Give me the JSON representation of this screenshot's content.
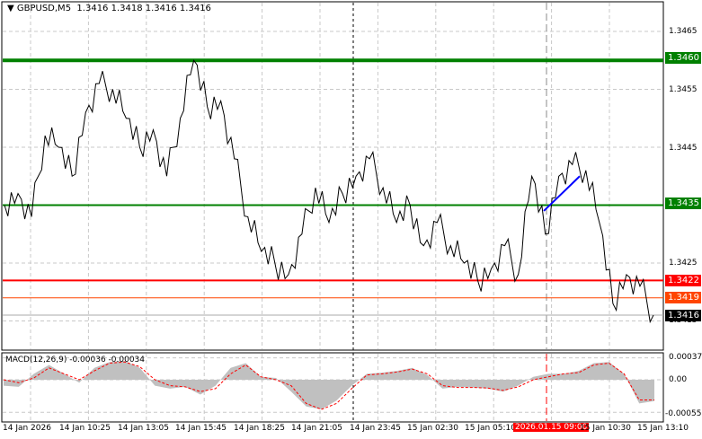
{
  "header": {
    "symbol": "GBPUSD,M5",
    "ohlc": "1.3416 1.3418 1.3416 1.3416"
  },
  "price_scale": [
    "1.3465",
    "1.3455",
    "1.3445",
    "1.3425",
    "1.3415"
  ],
  "levels": [
    {
      "price": 1.346,
      "label": "1.3460",
      "color": "#008000"
    },
    {
      "price": 1.3435,
      "label": "1.3435",
      "color": "#008000"
    },
    {
      "price": 1.3422,
      "label": "1.3422",
      "color": "#ff0000"
    },
    {
      "price": 1.3419,
      "label": "1.3419",
      "color": "#ff4500"
    },
    {
      "price": 1.3416,
      "label": "1.3416",
      "color": "#000000"
    }
  ],
  "macd": {
    "label": "MACD(12,26,9) -0.00036 -0.00034",
    "scale": [
      "0.00037",
      "0.00",
      "-0.00055"
    ]
  },
  "time_labels": [
    "14 Jan 2026",
    "14 Jan 10:25",
    "14 Jan 13:05",
    "14 Jan 15:45",
    "14 Jan 18:25",
    "14 Jan 21:05",
    "14 Jan 23:45",
    "15 Jan 02:30",
    "15 Jan 05:10",
    "2026.01.15 09:00",
    "15 Jan 10:30",
    "15 Jan 13:10"
  ],
  "chart_data": {
    "type": "line",
    "price": [
      1.3435,
      1.3437,
      1.3433,
      1.3447,
      1.3445,
      1.344,
      1.3451,
      1.3456,
      1.3455,
      1.345,
      1.3445,
      1.3448,
      1.344,
      1.345,
      1.346,
      1.3452,
      1.3453,
      1.3443,
      1.3433,
      1.3427,
      1.3425,
      1.3423,
      1.343,
      1.3438,
      1.3432,
      1.3437,
      1.344,
      1.3443,
      1.3438,
      1.3432,
      1.3435,
      1.3428,
      1.3432,
      1.3428,
      1.3425,
      1.3422,
      1.3424,
      1.3428,
      1.3423,
      1.344,
      1.343,
      1.344,
      1.3442,
      1.3441,
      1.3432,
      1.3418,
      1.3423,
      1.3421,
      1.3416
    ],
    "trendline": [
      1.3434,
      1.344
    ],
    "macd_hist": [
      -0.0001,
      -0.00012,
      0.0001,
      0.00025,
      0.0001,
      -5e-05,
      0.0002,
      0.0003,
      0.00032,
      0.0002,
      -0.0001,
      -0.00015,
      -0.00012,
      -0.00025,
      -0.0001,
      0.0002,
      0.00028,
      5e-05,
      3e-05,
      -0.0002,
      -0.00045,
      -0.0005,
      -0.00035,
      -0.0001,
      0.0001,
      0.00012,
      0.00015,
      0.0002,
      8e-05,
      -0.00015,
      -0.00012,
      -0.00013,
      -0.00015,
      -0.0002,
      -0.0001,
      5e-05,
      0.0001,
      0.0001,
      0.00015,
      0.00028,
      0.0003,
      0.0001,
      -0.0004,
      -0.00036
    ],
    "macd_signal": [
      0.0,
      -5e-05,
      3e-05,
      0.0002,
      0.0001,
      0.0,
      0.00015,
      0.00028,
      0.0003,
      0.00022,
      0.0,
      -0.0001,
      -0.00012,
      -0.0002,
      -0.00015,
      0.0001,
      0.00025,
      5e-05,
      0.0,
      -0.0001,
      -0.0004,
      -0.0005,
      -0.0004,
      -0.00015,
      8e-05,
      0.0001,
      0.00013,
      0.00018,
      0.0001,
      -0.0001,
      -0.00013,
      -0.00013,
      -0.00014,
      -0.00018,
      -0.00012,
      0.0,
      5e-05,
      0.0001,
      0.00012,
      0.00025,
      0.00028,
      0.0001,
      -0.00034,
      -0.00034
    ],
    "ylim": [
      1.3412,
      1.347
    ]
  }
}
